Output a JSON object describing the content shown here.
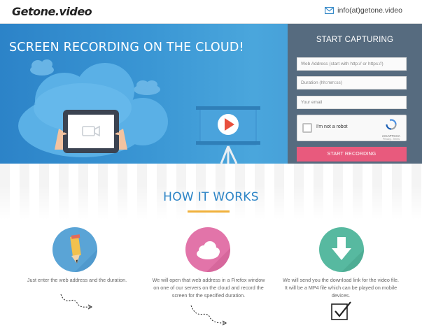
{
  "header": {
    "logo": "Getone.video",
    "contact_email": "info(at)getone.video",
    "contact_icon": "envelope-icon"
  },
  "hero": {
    "title": "SCREEN RECORDING ON THE CLOUD!"
  },
  "capture_form": {
    "title": "START CAPTURING",
    "web_address_placeholder": "Web Address (start with http:// or https://)",
    "duration_placeholder": "Duration (hh:mm:ss)",
    "email_placeholder": "Your email",
    "captcha_label": "I'm not a robot",
    "captcha_brand": "reCAPTCHA",
    "captcha_terms": "Privacy - Terms",
    "submit_label": "START RECORDING"
  },
  "how_it_works": {
    "title": "HOW IT WORKS",
    "steps": [
      {
        "icon": "pencil-icon",
        "color": "#5aa4d6",
        "text": "Just enter the web address and the duration."
      },
      {
        "icon": "cloud-icon",
        "color": "#e274a9",
        "text": "We will open that web address in a Firefox window on one of our servers on the cloud and record the screen for the specified duration."
      },
      {
        "icon": "download-arrow-icon",
        "color": "#57b9a0",
        "text": "We will send you the download link for the video file. It will be a MP4 file which can be played on mobile devices."
      }
    ]
  },
  "colors": {
    "accent_blue": "#2c84c6",
    "panel": "#566b7f",
    "button": "#e85a7d",
    "underline": "#f0b13c"
  }
}
